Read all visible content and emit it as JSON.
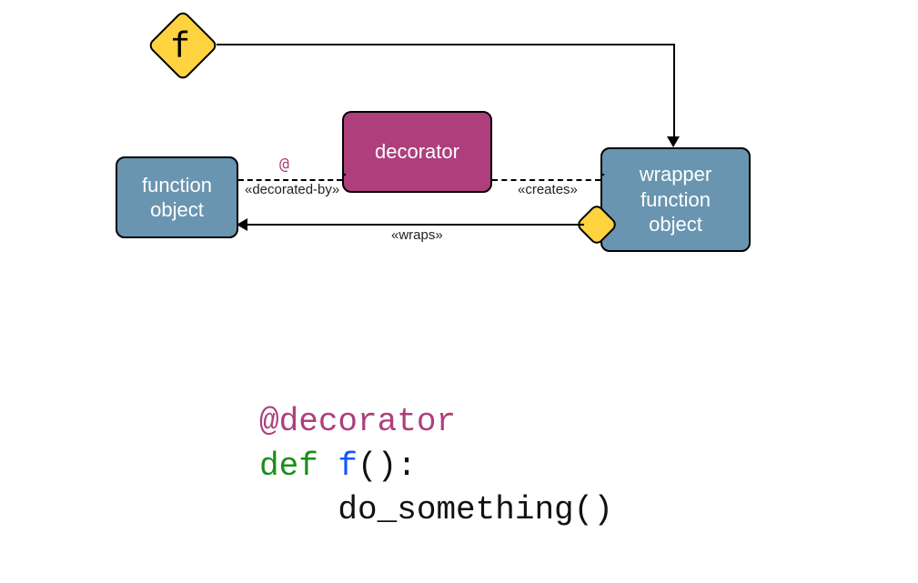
{
  "boxes": {
    "function_object": "function\nobject",
    "decorator": "decorator",
    "wrapper": "wrapper\nfunction\nobject"
  },
  "labels": {
    "f_symbol": "f",
    "at_symbol": "@",
    "decorated_by": "«decorated-by»",
    "creates": "«creates»",
    "wraps": "«wraps»"
  },
  "code": {
    "line1_prefix": "@",
    "line1_name": "decorator",
    "line2_kw": "def",
    "line2_fn": "f",
    "line2_rest": "():",
    "line3_indent": "    ",
    "line3_body": "do_something()"
  },
  "colors": {
    "blue": "#6a95b0",
    "magenta": "#ae3f7c",
    "yellow": "#ffd23f",
    "code_green": "#1a8f1a",
    "code_blue": "#1555ff"
  }
}
